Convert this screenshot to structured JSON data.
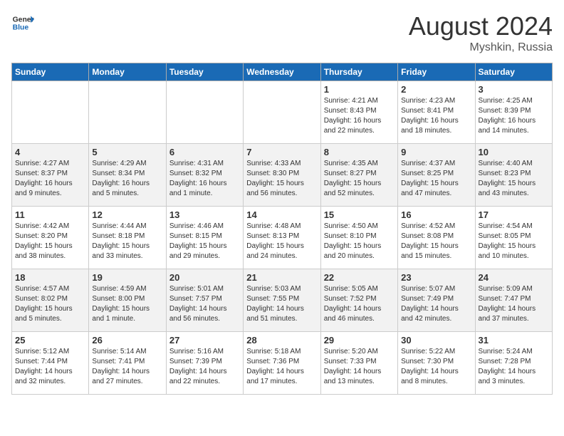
{
  "header": {
    "logo_line1": "General",
    "logo_line2": "Blue",
    "month_year": "August 2024",
    "location": "Myshkin, Russia"
  },
  "weekdays": [
    "Sunday",
    "Monday",
    "Tuesday",
    "Wednesday",
    "Thursday",
    "Friday",
    "Saturday"
  ],
  "weeks": [
    [
      {
        "day": "",
        "content": ""
      },
      {
        "day": "",
        "content": ""
      },
      {
        "day": "",
        "content": ""
      },
      {
        "day": "",
        "content": ""
      },
      {
        "day": "1",
        "content": "Sunrise: 4:21 AM\nSunset: 8:43 PM\nDaylight: 16 hours\nand 22 minutes."
      },
      {
        "day": "2",
        "content": "Sunrise: 4:23 AM\nSunset: 8:41 PM\nDaylight: 16 hours\nand 18 minutes."
      },
      {
        "day": "3",
        "content": "Sunrise: 4:25 AM\nSunset: 8:39 PM\nDaylight: 16 hours\nand 14 minutes."
      }
    ],
    [
      {
        "day": "4",
        "content": "Sunrise: 4:27 AM\nSunset: 8:37 PM\nDaylight: 16 hours\nand 9 minutes."
      },
      {
        "day": "5",
        "content": "Sunrise: 4:29 AM\nSunset: 8:34 PM\nDaylight: 16 hours\nand 5 minutes."
      },
      {
        "day": "6",
        "content": "Sunrise: 4:31 AM\nSunset: 8:32 PM\nDaylight: 16 hours\nand 1 minute."
      },
      {
        "day": "7",
        "content": "Sunrise: 4:33 AM\nSunset: 8:30 PM\nDaylight: 15 hours\nand 56 minutes."
      },
      {
        "day": "8",
        "content": "Sunrise: 4:35 AM\nSunset: 8:27 PM\nDaylight: 15 hours\nand 52 minutes."
      },
      {
        "day": "9",
        "content": "Sunrise: 4:37 AM\nSunset: 8:25 PM\nDaylight: 15 hours\nand 47 minutes."
      },
      {
        "day": "10",
        "content": "Sunrise: 4:40 AM\nSunset: 8:23 PM\nDaylight: 15 hours\nand 43 minutes."
      }
    ],
    [
      {
        "day": "11",
        "content": "Sunrise: 4:42 AM\nSunset: 8:20 PM\nDaylight: 15 hours\nand 38 minutes."
      },
      {
        "day": "12",
        "content": "Sunrise: 4:44 AM\nSunset: 8:18 PM\nDaylight: 15 hours\nand 33 minutes."
      },
      {
        "day": "13",
        "content": "Sunrise: 4:46 AM\nSunset: 8:15 PM\nDaylight: 15 hours\nand 29 minutes."
      },
      {
        "day": "14",
        "content": "Sunrise: 4:48 AM\nSunset: 8:13 PM\nDaylight: 15 hours\nand 24 minutes."
      },
      {
        "day": "15",
        "content": "Sunrise: 4:50 AM\nSunset: 8:10 PM\nDaylight: 15 hours\nand 20 minutes."
      },
      {
        "day": "16",
        "content": "Sunrise: 4:52 AM\nSunset: 8:08 PM\nDaylight: 15 hours\nand 15 minutes."
      },
      {
        "day": "17",
        "content": "Sunrise: 4:54 AM\nSunset: 8:05 PM\nDaylight: 15 hours\nand 10 minutes."
      }
    ],
    [
      {
        "day": "18",
        "content": "Sunrise: 4:57 AM\nSunset: 8:02 PM\nDaylight: 15 hours\nand 5 minutes."
      },
      {
        "day": "19",
        "content": "Sunrise: 4:59 AM\nSunset: 8:00 PM\nDaylight: 15 hours\nand 1 minute."
      },
      {
        "day": "20",
        "content": "Sunrise: 5:01 AM\nSunset: 7:57 PM\nDaylight: 14 hours\nand 56 minutes."
      },
      {
        "day": "21",
        "content": "Sunrise: 5:03 AM\nSunset: 7:55 PM\nDaylight: 14 hours\nand 51 minutes."
      },
      {
        "day": "22",
        "content": "Sunrise: 5:05 AM\nSunset: 7:52 PM\nDaylight: 14 hours\nand 46 minutes."
      },
      {
        "day": "23",
        "content": "Sunrise: 5:07 AM\nSunset: 7:49 PM\nDaylight: 14 hours\nand 42 minutes."
      },
      {
        "day": "24",
        "content": "Sunrise: 5:09 AM\nSunset: 7:47 PM\nDaylight: 14 hours\nand 37 minutes."
      }
    ],
    [
      {
        "day": "25",
        "content": "Sunrise: 5:12 AM\nSunset: 7:44 PM\nDaylight: 14 hours\nand 32 minutes."
      },
      {
        "day": "26",
        "content": "Sunrise: 5:14 AM\nSunset: 7:41 PM\nDaylight: 14 hours\nand 27 minutes."
      },
      {
        "day": "27",
        "content": "Sunrise: 5:16 AM\nSunset: 7:39 PM\nDaylight: 14 hours\nand 22 minutes."
      },
      {
        "day": "28",
        "content": "Sunrise: 5:18 AM\nSunset: 7:36 PM\nDaylight: 14 hours\nand 17 minutes."
      },
      {
        "day": "29",
        "content": "Sunrise: 5:20 AM\nSunset: 7:33 PM\nDaylight: 14 hours\nand 13 minutes."
      },
      {
        "day": "30",
        "content": "Sunrise: 5:22 AM\nSunset: 7:30 PM\nDaylight: 14 hours\nand 8 minutes."
      },
      {
        "day": "31",
        "content": "Sunrise: 5:24 AM\nSunset: 7:28 PM\nDaylight: 14 hours\nand 3 minutes."
      }
    ]
  ]
}
